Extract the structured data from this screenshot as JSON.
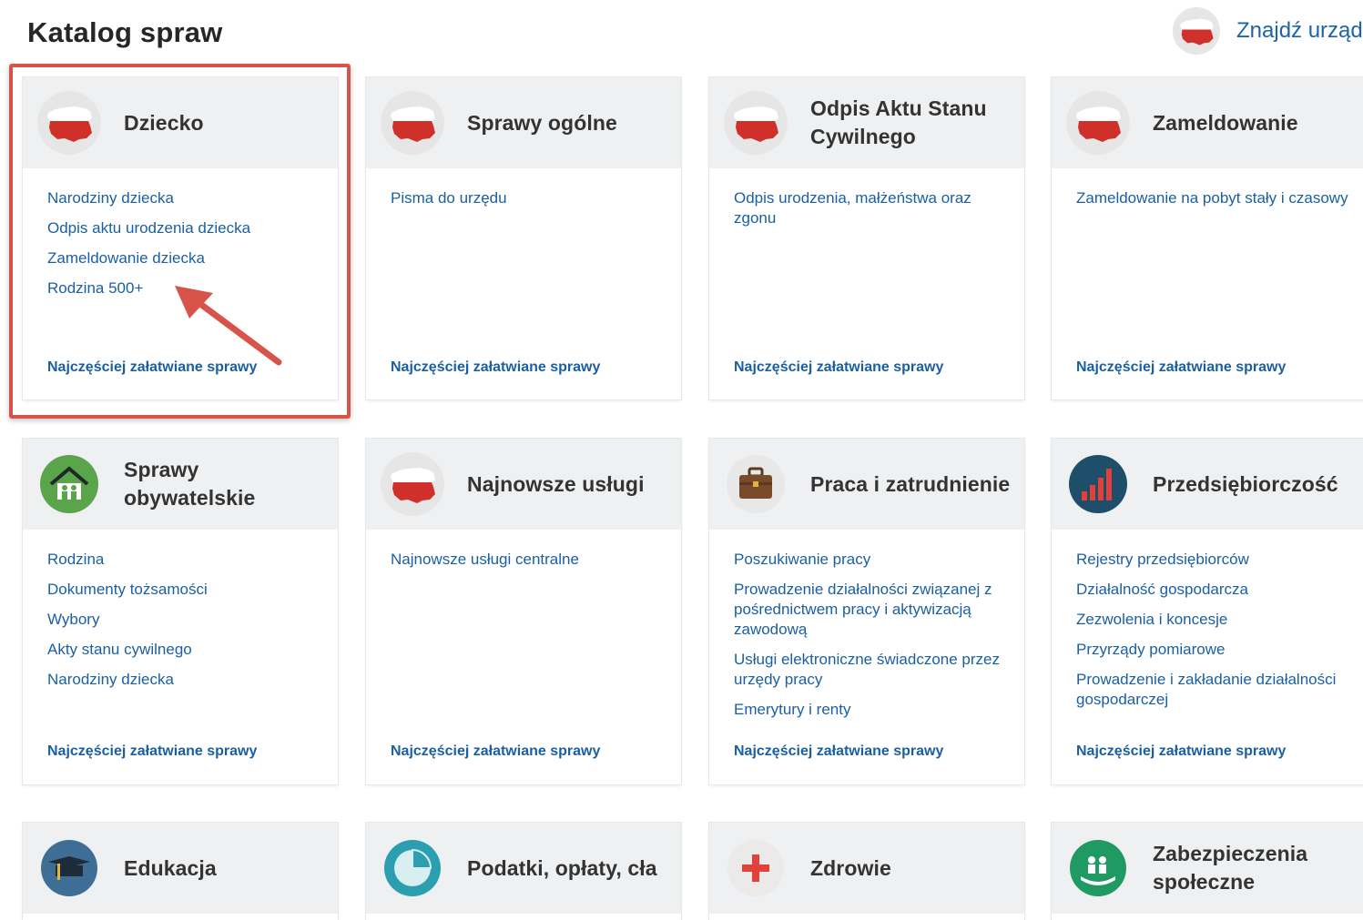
{
  "page_title": "Katalog spraw",
  "find_office": {
    "label": "Znajdź urząd",
    "icon": "poland-map-icon"
  },
  "frequent_label": "Najczęściej załatwiane sprawy",
  "colors": {
    "link": "#1b5fa3",
    "card_header": "#eef0f2",
    "highlight": "#d7544a",
    "poland_red": "#d0302a"
  },
  "cards": [
    {
      "title": "Dziecko",
      "icon": "poland-map-icon",
      "links": [
        "Narodziny dziecka",
        "Odpis aktu urodzenia dziecka",
        "Zameldowanie dziecka",
        "Rodzina 500+"
      ]
    },
    {
      "title": "Sprawy ogólne",
      "icon": "poland-map-icon",
      "links": [
        "Pisma do urzędu"
      ]
    },
    {
      "title": "Odpis Aktu Stanu Cywilnego",
      "icon": "poland-map-icon",
      "links": [
        "Odpis urodzenia, małżeństwa oraz zgonu"
      ]
    },
    {
      "title": "Zameldowanie",
      "icon": "poland-map-icon",
      "links": [
        "Zameldowanie na pobyt stały i czasowy"
      ]
    },
    {
      "title": "Sprawy obywatelskie",
      "icon": "family-house-icon",
      "links": [
        "Rodzina",
        "Dokumenty tożsamości",
        "Wybory",
        "Akty stanu cywilnego",
        "Narodziny dziecka"
      ]
    },
    {
      "title": "Najnowsze usługi",
      "icon": "poland-map-icon",
      "links": [
        "Najnowsze usługi centralne"
      ]
    },
    {
      "title": "Praca i zatrudnienie",
      "icon": "briefcase-icon",
      "links": [
        "Poszukiwanie pracy",
        "Prowadzenie działalności związanej z pośrednictwem pracy i aktywizacją zawodową",
        "Usługi elektroniczne świadczone przez urzędy pracy",
        "Emerytury i renty"
      ]
    },
    {
      "title": "Przedsiębiorczość",
      "icon": "bar-chart-icon",
      "links": [
        "Rejestry przedsiębiorców",
        "Działalność gospodarcza",
        "Zezwolenia i koncesje",
        "Przyrządy pomiarowe",
        "Prowadzenie i zakładanie działalności gospodarczej"
      ]
    },
    {
      "title": "Edukacja",
      "icon": "graduation-cap-icon",
      "links": []
    },
    {
      "title": "Podatki, opłaty, cła",
      "icon": "pie-chart-icon",
      "links": []
    },
    {
      "title": "Zdrowie",
      "icon": "medical-cross-icon",
      "links": []
    },
    {
      "title": "Zabezpieczenia społeczne",
      "icon": "family-hand-icon",
      "links": []
    }
  ]
}
